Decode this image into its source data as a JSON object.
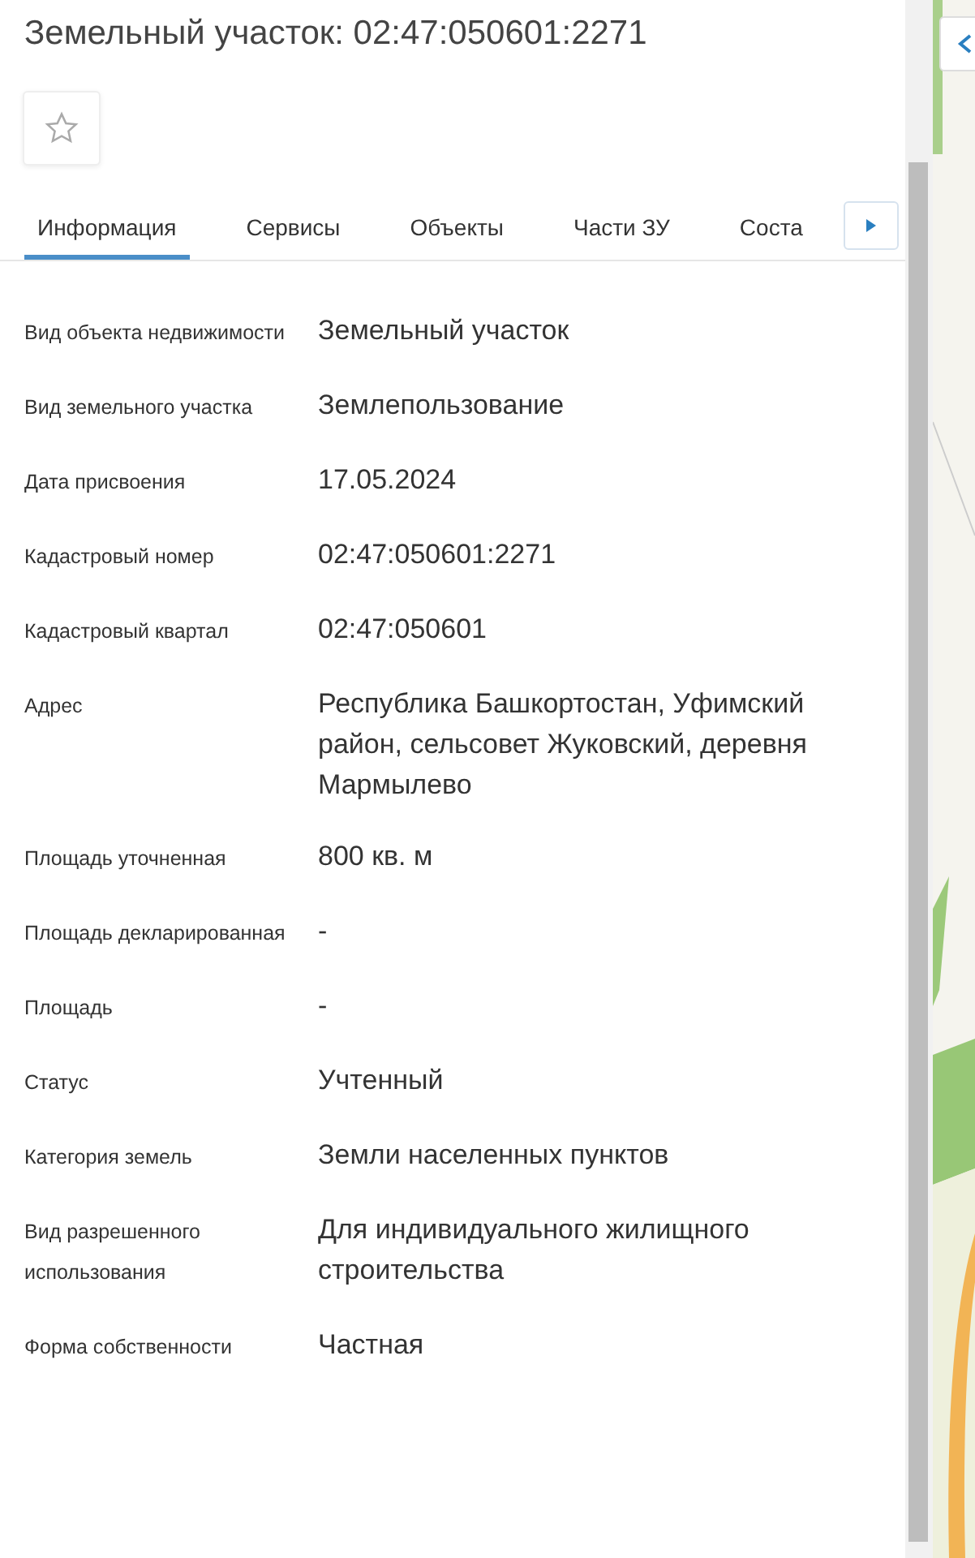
{
  "title": "Земельный участок: 02:47:050601:2271",
  "favorite": {
    "on": false
  },
  "tabs": [
    {
      "label": "Информация",
      "selected": true
    },
    {
      "label": "Сервисы",
      "selected": false
    },
    {
      "label": "Объекты",
      "selected": false
    },
    {
      "label": "Части ЗУ",
      "selected": false
    },
    {
      "label": "Соста",
      "selected": false
    }
  ],
  "fields": [
    {
      "label": "Вид объекта недвижимости",
      "value": "Земельный участок"
    },
    {
      "label": "Вид земельного участка",
      "value": "Землепользование"
    },
    {
      "label": "Дата присвоения",
      "value": "17.05.2024"
    },
    {
      "label": "Кадастровый номер",
      "value": "02:47:050601:2271"
    },
    {
      "label": "Кадастровый квартал",
      "value": "02:47:050601"
    },
    {
      "label": "Адрес",
      "value": "Республика Башкортостан, Уфимский район, сельсовет Жуковский, деревня Мармылево"
    },
    {
      "label": "Площадь уточненная",
      "value": "800 кв. м"
    },
    {
      "label": "Площадь декларированная",
      "value": "-"
    },
    {
      "label": "Площадь",
      "value": "-"
    },
    {
      "label": "Статус",
      "value": "Учтенный"
    },
    {
      "label": "Категория земель",
      "value": "Земли населенных пунктов"
    },
    {
      "label": "Вид разрешенного использования",
      "value": "Для индивидуального жилищного строительства"
    },
    {
      "label": "Форма собственности",
      "value": "Частная"
    }
  ]
}
